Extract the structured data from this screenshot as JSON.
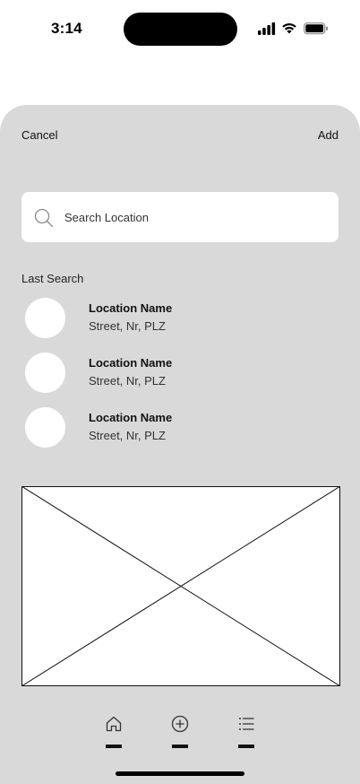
{
  "status_bar": {
    "time": "3:14"
  },
  "header": {
    "cancel_label": "Cancel",
    "add_label": "Add"
  },
  "search": {
    "placeholder": "Search Location",
    "value": ""
  },
  "last_search": {
    "title": "Last Search",
    "items": [
      {
        "name": "Location Name",
        "address": "Street, Nr, PLZ"
      },
      {
        "name": "Location Name",
        "address": "Street, Nr, PLZ"
      },
      {
        "name": "Location Name",
        "address": "Street, Nr, PLZ"
      }
    ]
  },
  "map": {
    "icon": "image-placeholder"
  },
  "tab_bar": {
    "tabs": [
      {
        "icon": "home-icon"
      },
      {
        "icon": "add-circle-icon"
      },
      {
        "icon": "list-icon"
      }
    ]
  },
  "colors": {
    "sheet_background": "#d9d9d9",
    "card_background": "#ffffff",
    "text": "#111111"
  }
}
